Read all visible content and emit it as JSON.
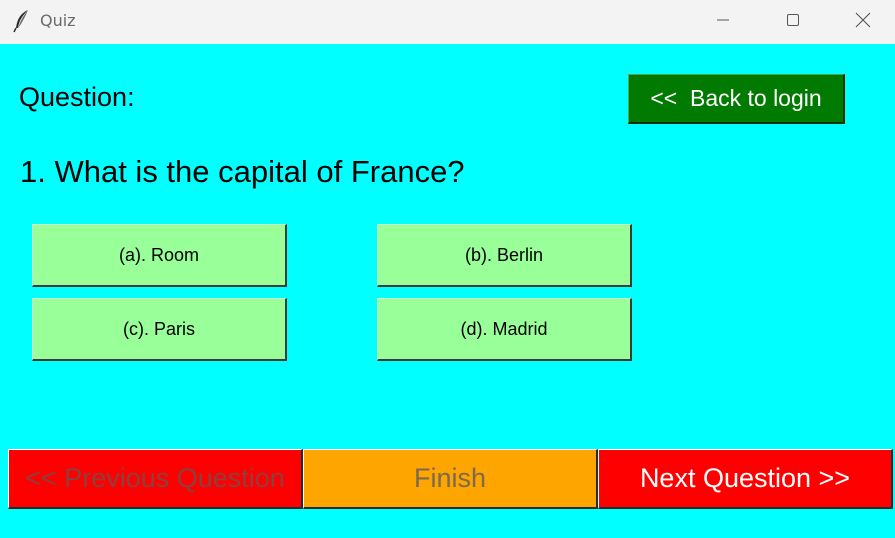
{
  "window": {
    "title": "Quiz",
    "icon": "feather-icon",
    "controls": [
      "minimize-icon",
      "maximize-icon",
      "close-icon"
    ]
  },
  "header": {
    "question_label": "Question:",
    "back_button_label": "<<  Back to login"
  },
  "question": {
    "text": "1. What is the capital of France?"
  },
  "options": [
    {
      "label": "(a). Room"
    },
    {
      "label": "(b). Berlin"
    },
    {
      "label": "(c). Paris"
    },
    {
      "label": "(d). Madrid"
    }
  ],
  "navigation": {
    "previous_label": "<< Previous Question",
    "finish_label": "Finish",
    "next_label": "Next Question >>",
    "previous_enabled": false,
    "finish_enabled": false,
    "next_enabled": true
  },
  "colors": {
    "background": "#00ffff",
    "back_button": "#007a00",
    "option_button": "#99ff99",
    "previous_button": "#ff0000",
    "finish_button": "#ffa500",
    "next_button": "#ff0000"
  }
}
